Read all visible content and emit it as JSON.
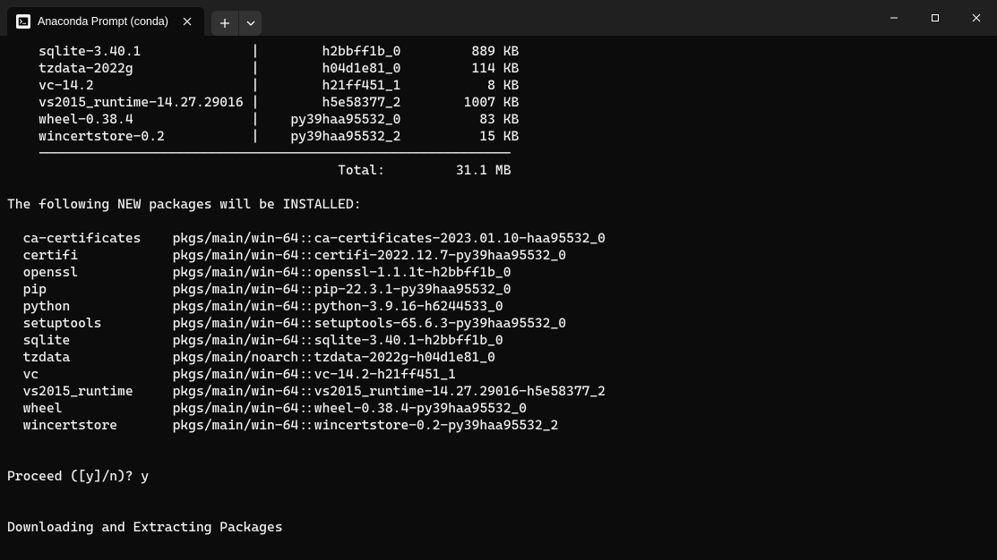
{
  "window": {
    "tab_title": "Anaconda Prompt (conda)"
  },
  "terminal": {
    "download_rows": [
      {
        "pkg": "sqlite-3.40.1",
        "build": "h2bbff1b_0",
        "size": "889 KB"
      },
      {
        "pkg": "tzdata-2022g",
        "build": "h04d1e81_0",
        "size": "114 KB"
      },
      {
        "pkg": "vc-14.2",
        "build": "h21ff451_1",
        "size": "8 KB"
      },
      {
        "pkg": "vs2015_runtime-14.27.29016",
        "build": "h5e58377_2",
        "size": "1007 KB"
      },
      {
        "pkg": "wheel-0.38.4",
        "build": "py39haa95532_0",
        "size": "83 KB"
      },
      {
        "pkg": "wincertstore-0.2",
        "build": "py39haa95532_2",
        "size": "15 KB"
      }
    ],
    "separator": "    ------------------------------------------------------------",
    "total_label": "Total:",
    "total_value": "31.1 MB",
    "install_header": "The following NEW packages will be INSTALLED:",
    "install_rows": [
      {
        "name": "ca-certificates",
        "spec": "pkgs/main/win-64::ca-certificates-2023.01.10-haa95532_0"
      },
      {
        "name": "certifi",
        "spec": "pkgs/main/win-64::certifi-2022.12.7-py39haa95532_0"
      },
      {
        "name": "openssl",
        "spec": "pkgs/main/win-64::openssl-1.1.1t-h2bbff1b_0"
      },
      {
        "name": "pip",
        "spec": "pkgs/main/win-64::pip-22.3.1-py39haa95532_0"
      },
      {
        "name": "python",
        "spec": "pkgs/main/win-64::python-3.9.16-h6244533_0"
      },
      {
        "name": "setuptools",
        "spec": "pkgs/main/win-64::setuptools-65.6.3-py39haa95532_0"
      },
      {
        "name": "sqlite",
        "spec": "pkgs/main/win-64::sqlite-3.40.1-h2bbff1b_0"
      },
      {
        "name": "tzdata",
        "spec": "pkgs/main/noarch::tzdata-2022g-h04d1e81_0"
      },
      {
        "name": "vc",
        "spec": "pkgs/main/win-64::vc-14.2-h21ff451_1"
      },
      {
        "name": "vs2015_runtime",
        "spec": "pkgs/main/win-64::vs2015_runtime-14.27.29016-h5e58377_2"
      },
      {
        "name": "wheel",
        "spec": "pkgs/main/win-64::wheel-0.38.4-py39haa95532_0"
      },
      {
        "name": "wincertstore",
        "spec": "pkgs/main/win-64::wincertstore-0.2-py39haa95532_2"
      }
    ],
    "proceed_line": "Proceed ([y]/n)? y",
    "downloading_line": "Downloading and Extracting Packages"
  }
}
